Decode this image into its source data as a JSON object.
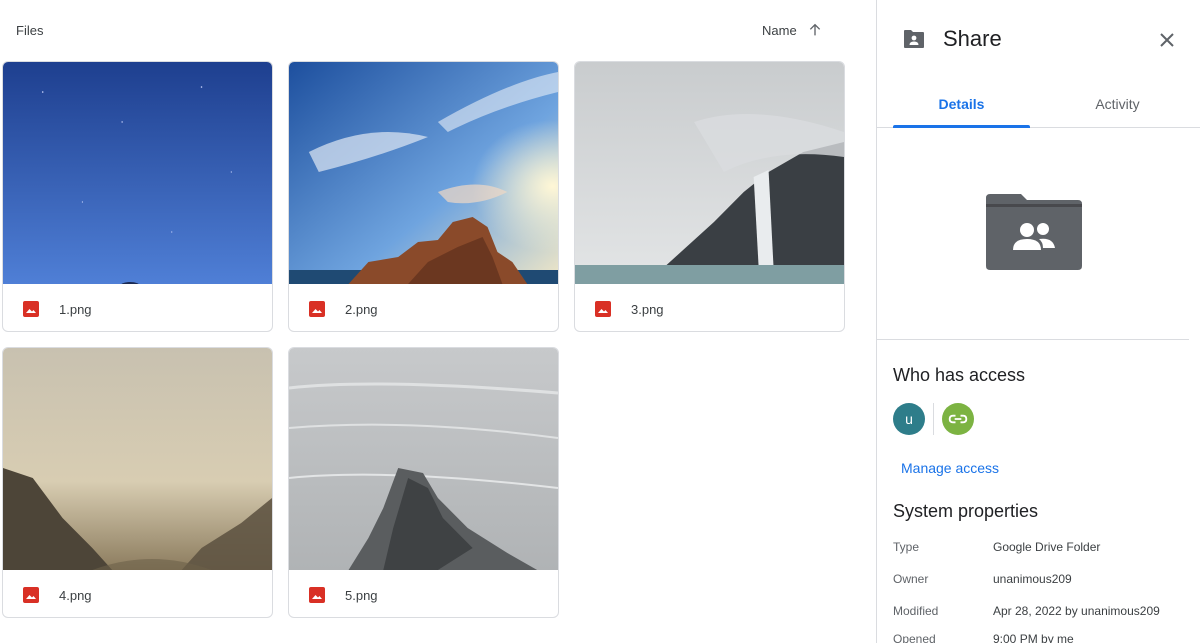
{
  "files": {
    "title": "Files",
    "sort_label": "Name",
    "items": [
      {
        "name": "1.png"
      },
      {
        "name": "2.png"
      },
      {
        "name": "3.png"
      },
      {
        "name": "4.png"
      },
      {
        "name": "5.png"
      }
    ]
  },
  "details": {
    "title": "Share",
    "tabs": [
      {
        "label": "Details",
        "active": true
      },
      {
        "label": "Activity",
        "active": false
      }
    ],
    "who_has_access": {
      "title": "Who has access",
      "avatar_letter": "u",
      "manage_label": "Manage access"
    },
    "system_properties": {
      "title": "System properties",
      "rows": [
        {
          "key": "Type",
          "value": "Google Drive Folder"
        },
        {
          "key": "Owner",
          "value": "unanimous209"
        },
        {
          "key": "Modified",
          "value": "Apr 28, 2022 by unanimous209"
        },
        {
          "key": "Opened",
          "value": "9:00 PM by me"
        }
      ]
    }
  },
  "colors": {
    "accent": "#1a73e8",
    "image_icon": "#d93025",
    "avatar": "#2e7d8a",
    "link_avatar": "#7cb342",
    "folder": "#5f6368"
  },
  "icons": [
    "arrow-up-icon",
    "image-file-icon",
    "shared-folder-icon",
    "close-icon",
    "link-icon"
  ]
}
